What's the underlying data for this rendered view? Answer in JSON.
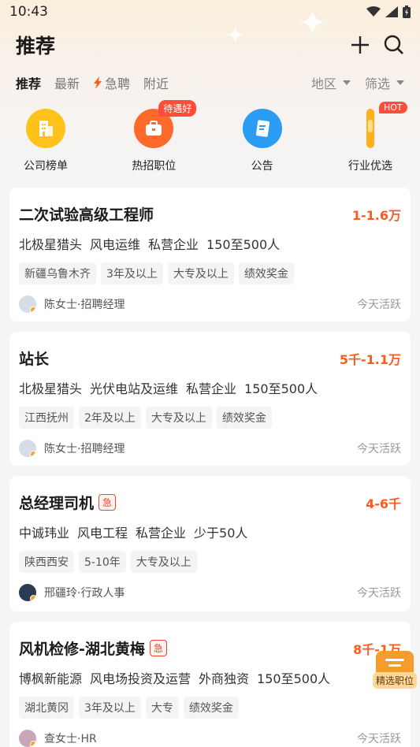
{
  "status_bar": {
    "time": "10:43"
  },
  "header": {
    "title": "推荐"
  },
  "tabs": [
    {
      "label": "推荐",
      "active": true
    },
    {
      "label": "最新",
      "active": false
    },
    {
      "label": "急聘",
      "active": false,
      "icon": "lightning-icon"
    },
    {
      "label": "附近",
      "active": false
    }
  ],
  "filters": [
    {
      "label": "地区"
    },
    {
      "label": "筛选"
    }
  ],
  "quick_links": [
    {
      "label": "公司榜单",
      "icon": "building-icon",
      "color": "#ffc21a"
    },
    {
      "label": "热招职位",
      "icon": "briefcase-icon",
      "color": "#ff6a2b",
      "badge": "待遇好"
    },
    {
      "label": "公告",
      "icon": "document-icon",
      "color": "#2a9cf4"
    },
    {
      "label": "行业优选",
      "icon": "medal-icon",
      "color": "#ffb01a",
      "badge": "HOT"
    }
  ],
  "jobs": [
    {
      "title": "二次试验高级工程师",
      "urgent": false,
      "salary": "1-1.6万",
      "company": [
        "北极星猎头",
        "风电运维",
        "私营企业",
        "150至500人"
      ],
      "tags": [
        "新疆乌鲁木齐",
        "3年及以上",
        "大专及以上",
        "绩效奖金"
      ],
      "contact": "陈女士·招聘经理",
      "activity": "今天活跃"
    },
    {
      "title": "站长",
      "urgent": false,
      "salary": "5千-1.1万",
      "company": [
        "北极星猎头",
        "光伏电站及运维",
        "私营企业",
        "150至500人"
      ],
      "tags": [
        "江西抚州",
        "2年及以上",
        "大专及以上",
        "绩效奖金"
      ],
      "contact": "陈女士·招聘经理",
      "activity": "今天活跃"
    },
    {
      "title": "总经理司机",
      "urgent": true,
      "urgent_label": "急",
      "salary": "4-6千",
      "company": [
        "中诚玮业",
        "风电工程",
        "私营企业",
        "少于50人"
      ],
      "tags": [
        "陕西西安",
        "5-10年",
        "大专及以上"
      ],
      "contact": "邢疆玲·行政人事",
      "activity": "今天活跃"
    },
    {
      "title": "风机检修-湖北黄梅",
      "urgent": true,
      "urgent_label": "急",
      "salary": "8千-1万",
      "company": [
        "博枫新能源",
        "风电场投资及运营",
        "外商独资",
        "150至500人"
      ],
      "tags": [
        "湖北黄冈",
        "3年及以上",
        "大专",
        "绩效奖金"
      ],
      "contact": "查女士·HR",
      "activity": "今天活跃"
    }
  ],
  "floating_button": {
    "label": "精选职位",
    "icon": "list-box-icon"
  }
}
